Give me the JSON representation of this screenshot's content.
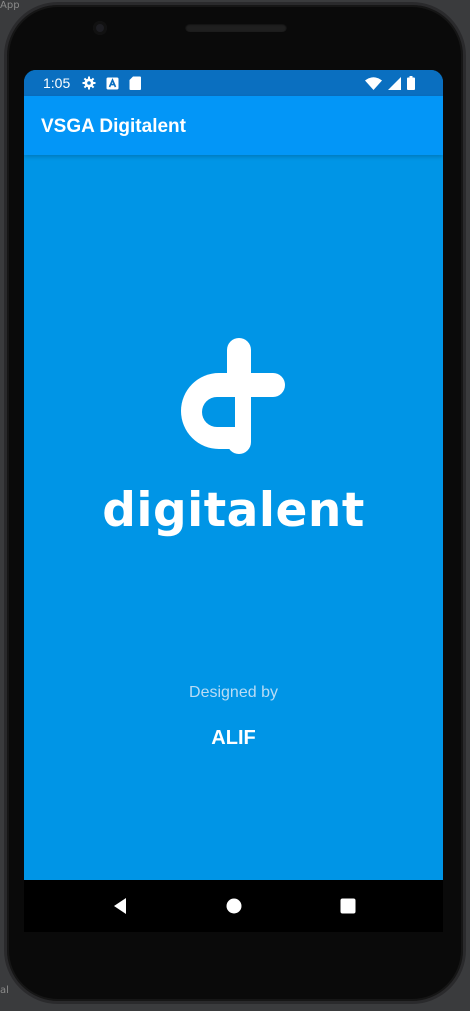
{
  "background": {
    "top_left_text": "App",
    "bottom_left_text": "al"
  },
  "status_bar": {
    "time": "1:05",
    "icons_left": [
      "gear-icon",
      "font-a-icon",
      "sd-card-icon"
    ],
    "icons_right": [
      "wifi-icon",
      "signal-icon",
      "battery-icon"
    ]
  },
  "app_bar": {
    "title": "VSGA Digitalent"
  },
  "splash": {
    "brand_name": "digitalent",
    "designed_by_label": "Designed by",
    "author": "ALIF"
  },
  "navigation": {
    "buttons": [
      "back-button",
      "home-button",
      "recents-button"
    ]
  },
  "colors": {
    "screen_bg": "#0095e6",
    "app_bar_bg": "#0396f7",
    "status_bar_bg": "#0a6fc0",
    "text_primary": "#ffffff",
    "text_muted": "#b9dcf5"
  }
}
